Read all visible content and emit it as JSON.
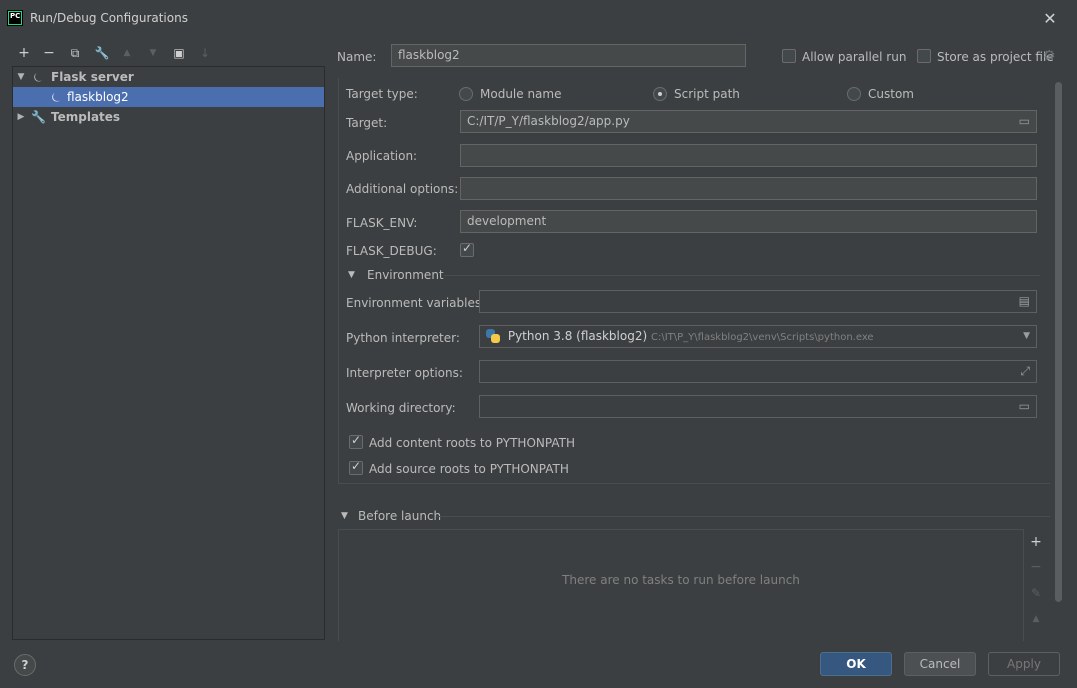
{
  "window": {
    "title": "Run/Debug Configurations",
    "logo_text": "PC",
    "close_glyph": "✕"
  },
  "toolbar": {
    "add": "+",
    "remove": "−",
    "copy": "⧉",
    "edit": "🔧",
    "up": "▲",
    "down": "▼",
    "folder": "▣",
    "sort": "↓"
  },
  "tree": {
    "items": [
      {
        "label": "Flask server",
        "icon": "flask-icon"
      },
      {
        "label": "flaskblog2",
        "icon": "flask-icon"
      },
      {
        "label": "Templates",
        "icon": "wrench-icon"
      }
    ]
  },
  "header": {
    "name_label": "Name:",
    "name_value": "flaskblog2",
    "allow_parallel_label": "Allow parallel run",
    "store_project_label": "Store as project file"
  },
  "form": {
    "target_type_label": "Target type:",
    "target_types": [
      "Module name",
      "Script path",
      "Custom"
    ],
    "selected_target_type": "Script path",
    "target_label": "Target:",
    "target_value": "C:/IT/P_Y/flaskblog2/app.py",
    "application_label": "Application:",
    "application_value": "",
    "additional_label": "Additional options:",
    "additional_value": "",
    "flask_env_label": "FLASK_ENV:",
    "flask_env_value": "development",
    "flask_debug_label": "FLASK_DEBUG:",
    "flask_debug_checked": true
  },
  "environment": {
    "section_label": "Environment",
    "env_vars_label": "Environment variables:",
    "env_vars_value": "",
    "interpreter_label": "Python interpreter:",
    "interpreter_name": "Python 3.8 (flaskblog2)",
    "interpreter_path": "C:\\IT\\P_Y\\flaskblog2\\venv\\Scripts\\python.exe",
    "interp_options_label": "Interpreter options:",
    "interp_options_value": "",
    "working_dir_label": "Working directory:",
    "working_dir_value": "",
    "content_roots_label": "Add content roots to PYTHONPATH",
    "source_roots_label": "Add source roots to PYTHONPATH"
  },
  "before_launch": {
    "section_label": "Before launch",
    "empty_message": "There are no tasks to run before launch"
  },
  "buttons": {
    "ok": "OK",
    "cancel": "Cancel",
    "apply": "Apply",
    "help": "?"
  },
  "colors": {
    "background": "#3c3f41",
    "selection": "#4b6eaf",
    "primary_button": "#365880"
  }
}
